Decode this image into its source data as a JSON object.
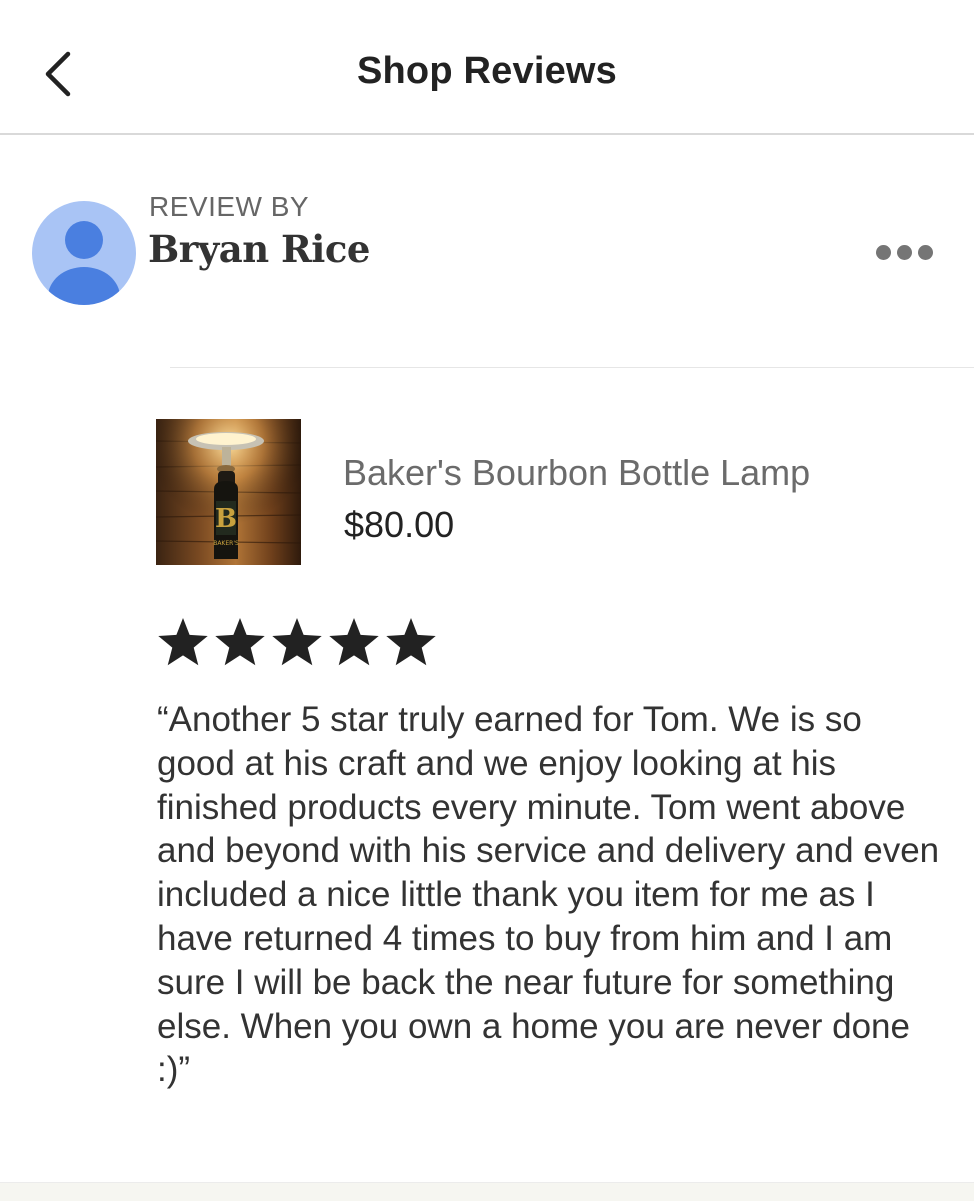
{
  "header": {
    "title": "Shop Reviews",
    "back_icon": "chevron-left-icon"
  },
  "review": {
    "label": "REVIEW BY",
    "reviewer_name": "Bryan Rice",
    "avatar_icon": "default-user-avatar",
    "more_icon": "more-horizontal-icon",
    "rating": 5,
    "rating_max": 5,
    "text": "“Another 5 star truly earned for Tom.  We is so good at his craft and we enjoy looking at his finished products every minute.  Tom went above and beyond with his service and delivery and even included a nice little thank you item for me as I have returned 4 times to buy from him and I am sure I will be back the near future for something else.  When you own a home you are never done :)”"
  },
  "listing": {
    "title": "Baker's Bourbon Bottle Lamp",
    "price": "$80.00",
    "thumbnail_label": "BAKER'S",
    "thumbnail_letter": "B"
  },
  "colors": {
    "avatar_bg": "#a9c4f5",
    "avatar_fg": "#4a7fe0",
    "star": "#222222",
    "divider": "#d9d9d9"
  }
}
